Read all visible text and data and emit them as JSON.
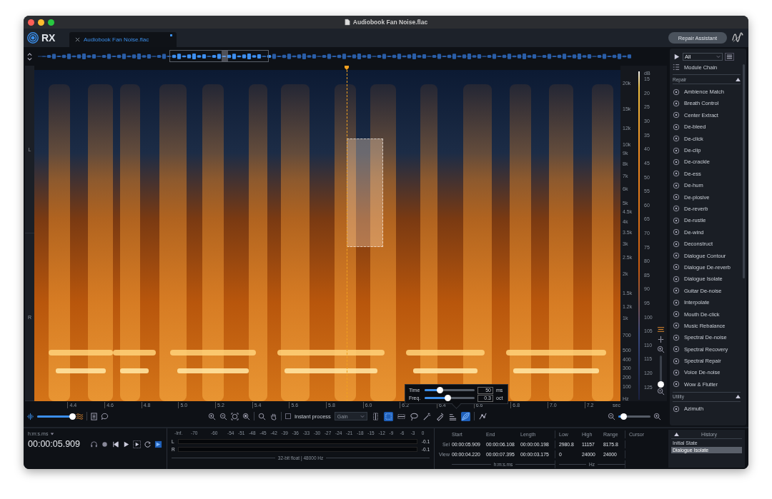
{
  "window": {
    "title": "Audiobook Fan Noise.flac"
  },
  "app": {
    "logo": "RX"
  },
  "tabs": [
    {
      "label": "Audiobook Fan Noise.flac",
      "selected": true,
      "modified": true
    }
  ],
  "header": {
    "repair_assistant": "Repair Assistant"
  },
  "spectrogram": {
    "channels": [
      "L",
      "R"
    ],
    "freq_labels": [
      "20k",
      "15k",
      "12k",
      "10k",
      "9k",
      "8k",
      "7k",
      "6k",
      "5k",
      "4.5k",
      "4k",
      "3.5k",
      "3k",
      "2.5k",
      "2k",
      "1.5k",
      "1.2k",
      "1k",
      "700",
      "500",
      "400",
      "300",
      "200",
      "100"
    ],
    "freq_unit": "Hz",
    "db_unit": "dB",
    "db_labels": [
      "15",
      "20",
      "25",
      "30",
      "35",
      "40",
      "45",
      "50",
      "55",
      "60",
      "65",
      "70",
      "75",
      "80",
      "85",
      "90",
      "95",
      "100",
      "105",
      "110",
      "115",
      "120",
      "125"
    ],
    "time_labels": [
      "4.4",
      "4.6",
      "4.8",
      "5.0",
      "5.2",
      "5.4",
      "5.6",
      "5.8",
      "6.0",
      "6.2",
      "6.4",
      "6.6",
      "6.8",
      "7.0",
      "7.2"
    ],
    "time_unit": "sec",
    "vertical_zoom": {
      "level": 0.02
    }
  },
  "popup": {
    "rows": [
      {
        "label": "Time",
        "level": 0.3,
        "value": "50",
        "unit": "ms"
      },
      {
        "label": "Freq.",
        "level": 0.45,
        "value": "0.3",
        "unit": "oct"
      }
    ]
  },
  "toolbar": {
    "waveform_opacity": {
      "level": 0.97
    },
    "instant_process": {
      "label": "Instant process",
      "checked": false
    },
    "mode": "Gain",
    "tools": [
      {
        "kind": "time",
        "selected": false
      },
      {
        "kind": "rect",
        "selected": true
      },
      {
        "kind": "freq",
        "selected": false
      },
      {
        "kind": "lasso",
        "selected": false
      },
      {
        "kind": "wand",
        "selected": false
      },
      {
        "kind": "brush",
        "selected": false
      },
      {
        "kind": "harmonic",
        "selected": false
      },
      {
        "kind": "feather",
        "selected": true
      },
      {
        "kind": "curve",
        "selected": false
      }
    ],
    "horizontal_zoom": {
      "level": 0.15
    }
  },
  "modules_panel": {
    "filter": "All",
    "module_chain": "Module Chain",
    "sections": [
      {
        "title": "Repair",
        "expanded": true,
        "modules": [
          "Ambience Match",
          "Breath Control",
          "Center Extract",
          "De-bleed",
          "De-click",
          "De-clip",
          "De-crackle",
          "De-ess",
          "De-hum",
          "De-plosive",
          "De-reverb",
          "De-rustle",
          "De-wind",
          "Deconstruct",
          "Dialogue Contour",
          "Dialogue De-reverb",
          "Dialogue Isolate",
          "Guitar De-noise",
          "Interpolate",
          "Mouth De-click",
          "Music Rebalance",
          "Spectral De-noise",
          "Spectral Recovery",
          "Spectral Repair",
          "Voice De-noise",
          "Wow & Flutter"
        ]
      },
      {
        "title": "Utility",
        "expanded": true,
        "modules": [
          "Azimuth"
        ]
      }
    ]
  },
  "transport": {
    "time_format": "h:m:s.ms",
    "time": "00:00:05.909"
  },
  "meter": {
    "scale": [
      "-Inf.",
      "-70",
      "-60",
      "-54",
      "-51",
      "-48",
      "-45",
      "-42",
      "-39",
      "-36",
      "-33",
      "-30",
      "-27",
      "-24",
      "-21",
      "-18",
      "-15",
      "-12",
      "-9",
      "-6",
      "-3",
      "0"
    ],
    "channels": [
      {
        "name": "L",
        "peak": "-0.1"
      },
      {
        "name": "R",
        "peak": "-0.1"
      }
    ],
    "format": "32-bit float | 48000 Hz"
  },
  "selection_info": {
    "time_columns": [
      "Start",
      "End",
      "Length"
    ],
    "freq_columns": [
      "Low",
      "High",
      "Range"
    ],
    "cursor": "Cursor",
    "rows": [
      {
        "label": "Sel",
        "times": [
          "00:00:05.909",
          "00:00:06.108",
          "00:00:00.198"
        ],
        "freqs": [
          "2980.8",
          "11157",
          "8175.8"
        ]
      },
      {
        "label": "View",
        "times": [
          "00:00:04.220",
          "00:00:07.395",
          "00:00:03.175"
        ],
        "freqs": [
          "0",
          "24000",
          "24000"
        ]
      }
    ],
    "time_unit": "h:m:s.ms",
    "freq_unit": "Hz"
  },
  "history": {
    "title": "History",
    "expanded": true,
    "items": [
      {
        "label": "Initial State",
        "selected": false
      },
      {
        "label": "Dialogue Isolate",
        "selected": true
      }
    ]
  }
}
